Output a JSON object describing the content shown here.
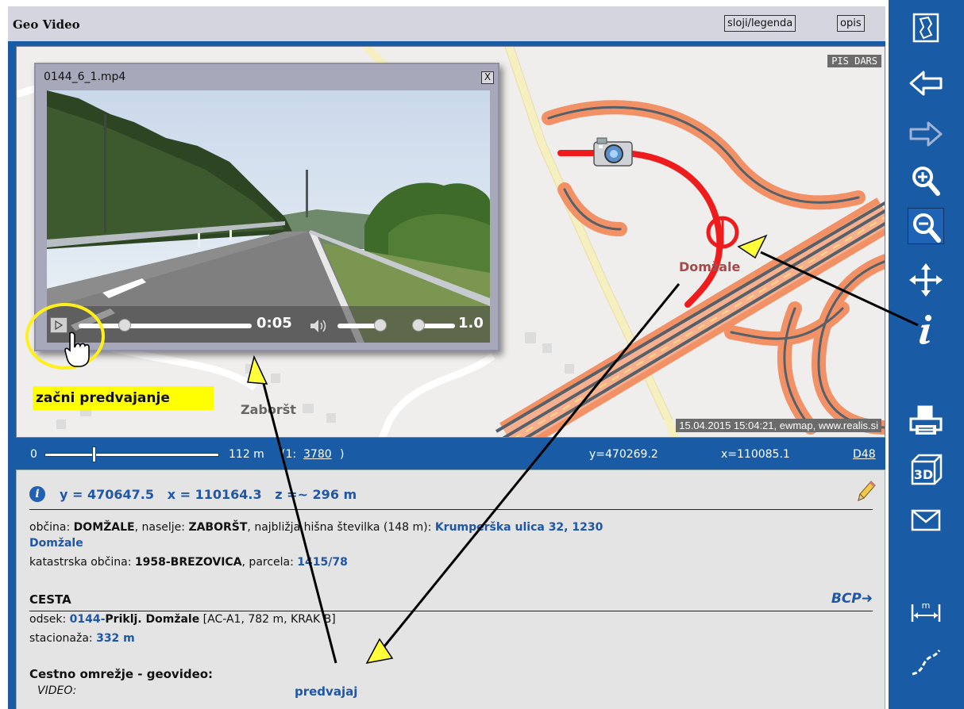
{
  "header": {
    "title": "Geo Video",
    "layers_button": "sloji/legenda",
    "description_button": "opis"
  },
  "map": {
    "source_badge": "PIS DARS",
    "copyright": "15.04.2015 15:04:21, ewmap, www.realis.si",
    "place_labels": [
      "Domžale",
      "Zaboršt"
    ],
    "callout": "začni predvajanje"
  },
  "video": {
    "filename": "0144_6_1.mp4",
    "close_label": "X",
    "time": "0:05",
    "speed": "1.0"
  },
  "status": {
    "scale_min": "0",
    "scale_value": "112 m",
    "scale_ratio_prefix": "(1:",
    "scale_ratio": "3780",
    "scale_ratio_suffix": ")",
    "coord_y": "y=470269.2",
    "coord_x": "x=110085.1",
    "region_link": "D48"
  },
  "info": {
    "coords": "y = 470647.5   x = 110164.3   z =~ 296 m",
    "municipality_label": "občina:",
    "municipality": "DOMŽALE",
    "settlement_label": ", naselje:",
    "settlement": "ZABORŠT",
    "nearest_label": ", najbližja hišna številka (148 m):",
    "address_line1": "Krumperška ulica 32, 1230",
    "address_line2": "Domžale",
    "cadastral_label": "katastrska občina:",
    "cadastral": "1958-BREZOVICA",
    "parcel_label": ", parcela:",
    "parcel": "1415/78",
    "road_title": "CESTA",
    "bcp_link": "BCP➜",
    "section_label": "odsek:",
    "section_code": "0144-",
    "section_name": "Priklj. Domžale",
    "section_detail": " [AC-A1, 782 m, KRAK B]",
    "chainage_label": "stacionaža:",
    "chainage": "332 m",
    "geovideo_title": "Cestno omrežje - geovideo:",
    "video_label": "VIDEO:",
    "play_link": "predvajaj"
  },
  "toolbar": {
    "tools": [
      "map-icon",
      "back-arrow-icon",
      "forward-arrow-icon",
      "zoom-in-icon",
      "zoom-out-icon",
      "pan-icon",
      "info-icon",
      "print-icon",
      "3d-icon",
      "mail-icon",
      "measure-distance-icon",
      "elevation-profile-icon"
    ],
    "measure_unit": "m",
    "three_d_label": "3D"
  },
  "colors": {
    "frame_blue": "#1a5ba6",
    "highway_orange": "#f08a5a",
    "route_red": "#ee1c1c",
    "callout_yellow": "#ffff00",
    "link_blue": "#1f56a8"
  }
}
